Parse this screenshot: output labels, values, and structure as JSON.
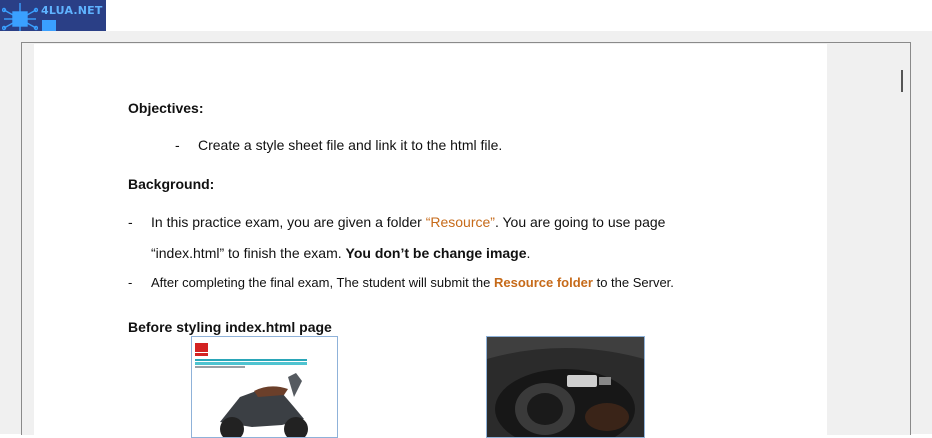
{
  "logo": {
    "text": "4LUA.NET"
  },
  "doc": {
    "objectives_heading": "Objectives:",
    "objective_bullet": "-",
    "objective_item": "Create a style sheet file and link it to the html file.",
    "background_heading": "Background:",
    "bullet": "-",
    "bg1_part1": "In this practice exam, you are given a folder ",
    "bg1_resource": "“Resource”",
    "bg1_part2": ". You are going to use page",
    "bg1_line2_part1": "“index.html”  to finish the exam. ",
    "bg1_line2_bold": "You don’t be change image",
    "bg1_line2_end": ".",
    "bg2_part1": "After completing the final exam, The student will submit the ",
    "bg2_resource": "Resource folder",
    "bg2_part2": " to the Server.",
    "before_heading": "Before styling index.html page"
  },
  "colors": {
    "accent_orange": "#c66a19",
    "logo_bg": "#2a3f86"
  }
}
